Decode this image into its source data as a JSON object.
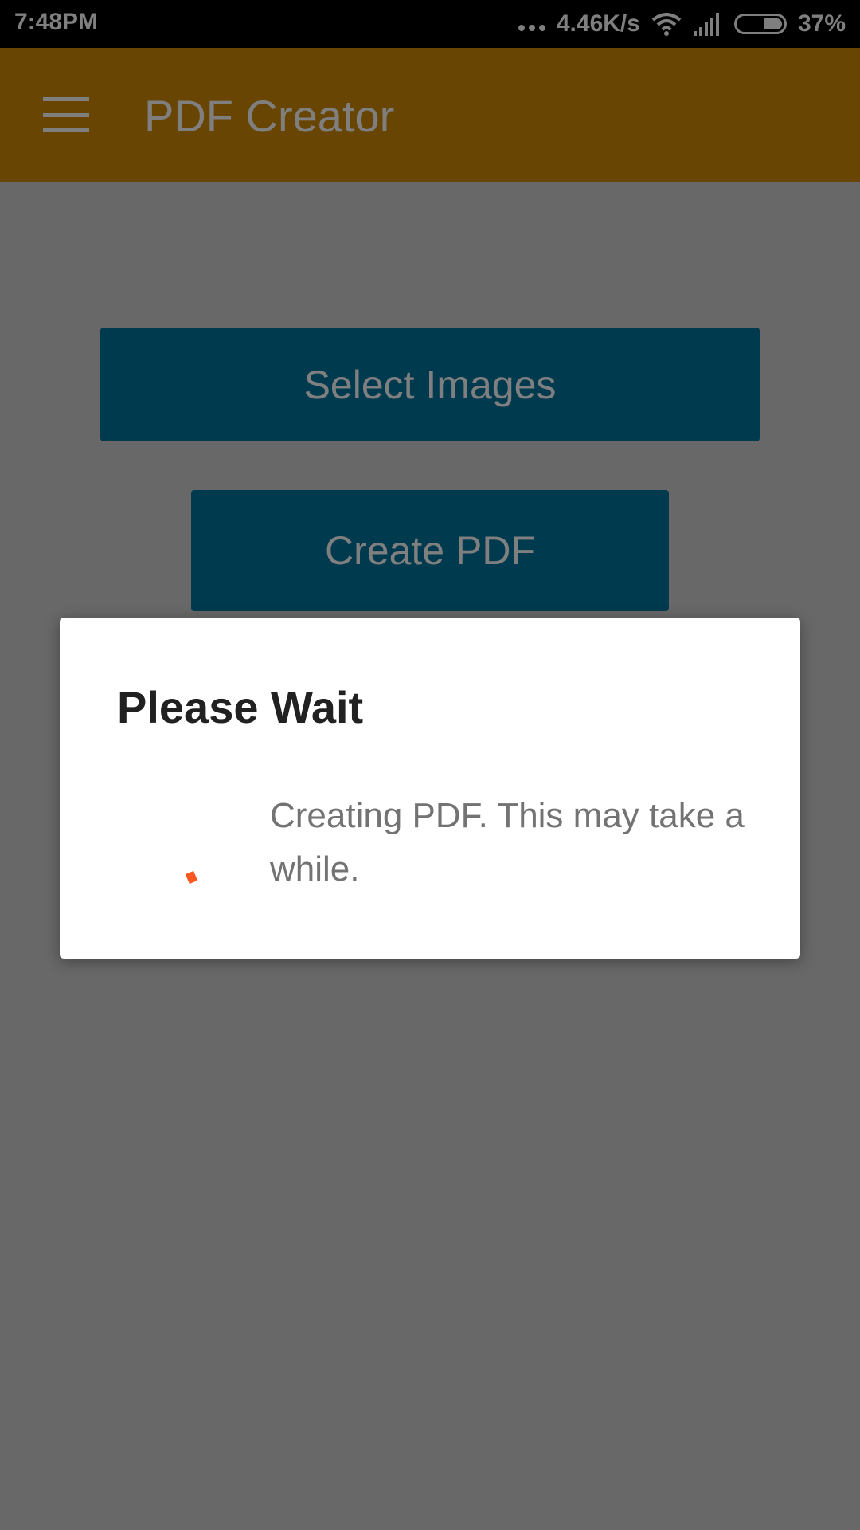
{
  "status_bar": {
    "time": "7:48PM",
    "network_speed": "4.46K/s",
    "battery_percent": "37%",
    "battery_level": 0.37,
    "icons": [
      "more-dots-icon",
      "wifi-icon",
      "cellular-signal-icon",
      "battery-icon"
    ]
  },
  "app_bar": {
    "title": "PDF Creator",
    "menu_icon": "hamburger-menu-icon",
    "background_color": "#d18b06"
  },
  "main": {
    "select_images_label": "Select Images",
    "create_pdf_label": "Create PDF",
    "button_color": "#01749f"
  },
  "dialog": {
    "title": "Please Wait",
    "message": "Creating PDF. This may take a while.",
    "spinner_color": "#ff5722"
  }
}
